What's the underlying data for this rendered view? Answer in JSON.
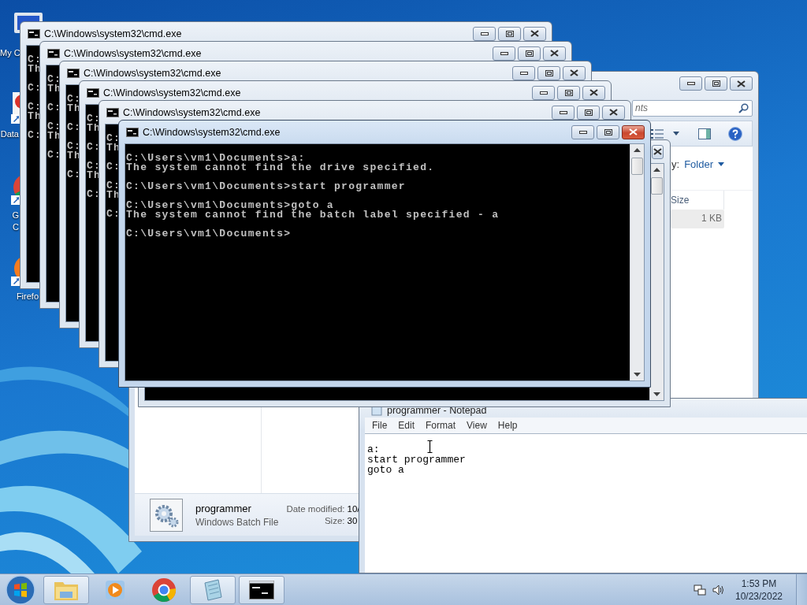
{
  "desktop_icons": [
    {
      "kind": "computer",
      "label_lines": [
        "My C"
      ]
    },
    {
      "kind": "data",
      "label_lines": [
        "Data"
      ]
    },
    {
      "kind": "chrome",
      "label_lines": [
        "G",
        "C"
      ]
    },
    {
      "kind": "firefox",
      "label_lines": [
        "Firefo"
      ]
    }
  ],
  "explorer": {
    "search": {
      "placeholder": "nts"
    },
    "arrange_label": "y:",
    "arrange_value": "Folder",
    "columns": [
      "Size"
    ],
    "rows": [
      {
        "size": "1 KB"
      }
    ],
    "details": {
      "name": "programmer",
      "type": "Windows Batch File",
      "fields": [
        {
          "label": "Date modified:",
          "value": "10/"
        },
        {
          "label": "Size:",
          "value": "30"
        }
      ]
    }
  },
  "notepad": {
    "title": "programmer - Notepad",
    "menu": [
      "File",
      "Edit",
      "Format",
      "View",
      "Help"
    ],
    "text_lines": [
      "a:",
      "start programmer",
      "goto a"
    ]
  },
  "cmd_windows": [
    {
      "title": "C:\\Windows\\system32\\cmd.exe",
      "active": false,
      "blocks": [
        [
          "C:",
          "Th"
        ],
        [
          "C:"
        ],
        [
          "C:",
          "Th"
        ],
        [
          "C:"
        ]
      ]
    },
    {
      "title": "C:\\Windows\\system32\\cmd.exe",
      "active": false,
      "blocks": [
        [
          "C:",
          "Th"
        ],
        [
          "C:"
        ],
        [
          "C:",
          "Th"
        ],
        [
          "C:"
        ]
      ]
    },
    {
      "title": "C:\\Windows\\system32\\cmd.exe",
      "active": false,
      "blocks": [
        [
          "C:",
          "Th"
        ],
        [
          "C:"
        ],
        [
          "C:",
          "Th"
        ],
        [
          "C:"
        ]
      ]
    },
    {
      "title": "C:\\Windows\\system32\\cmd.exe",
      "active": false,
      "blocks": [
        [
          "C:",
          "Th"
        ],
        [
          "C:"
        ],
        [
          "C:",
          "Th"
        ],
        [
          "C:"
        ]
      ]
    },
    {
      "title": "C:\\Windows\\system32\\cmd.exe",
      "active": false,
      "blocks": [
        [
          "C:",
          "Th"
        ],
        [
          "C:"
        ],
        [
          "C:",
          "Th"
        ],
        [
          "C:"
        ]
      ]
    },
    {
      "title": "C:\\Windows\\system32\\cmd.exe",
      "active": true,
      "blocks": [
        [
          "C:\\Users\\vm1\\Documents>a:",
          "The system cannot find the drive specified."
        ],
        [
          "C:\\Users\\vm1\\Documents>start programmer"
        ],
        [
          "C:\\Users\\vm1\\Documents>goto a",
          "The system cannot find the batch label specified - a"
        ],
        [
          "C:\\Users\\vm1\\Documents>"
        ]
      ]
    },
    {
      "active": false
    }
  ],
  "taskbar": {
    "apps": [
      {
        "kind": "explorer",
        "open": true
      },
      {
        "kind": "media",
        "open": false
      },
      {
        "kind": "chrome",
        "open": false
      },
      {
        "kind": "notepad",
        "open": true
      },
      {
        "kind": "cmd",
        "open": true
      }
    ],
    "time": "1:53 PM",
    "date": "10/23/2022"
  }
}
